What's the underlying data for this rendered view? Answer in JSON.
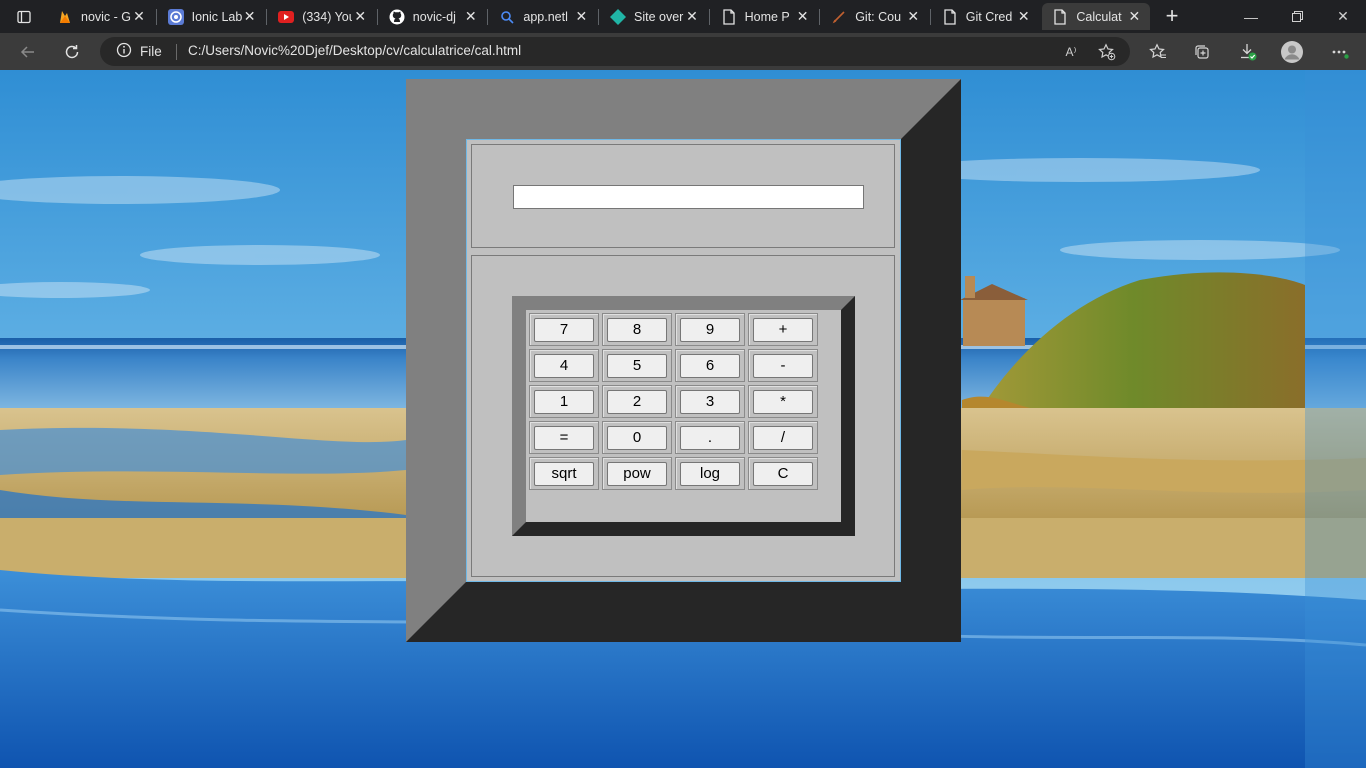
{
  "browser": {
    "tabs": [
      {
        "title": "novic - G",
        "icon": "firebase-icon",
        "active": false
      },
      {
        "title": "Ionic Lab",
        "icon": "ionic-icon",
        "active": false
      },
      {
        "title": "(334) You",
        "icon": "youtube-icon",
        "active": false
      },
      {
        "title": "novic-dj",
        "icon": "github-icon",
        "active": false
      },
      {
        "title": "app.netl",
        "icon": "search-icon",
        "active": false
      },
      {
        "title": "Site over",
        "icon": "netlify-icon",
        "active": false
      },
      {
        "title": "Home P",
        "icon": "page-icon",
        "active": false
      },
      {
        "title": "Git: Cou",
        "icon": "git-icon",
        "active": false
      },
      {
        "title": "Git Cred",
        "icon": "page-icon",
        "active": false
      },
      {
        "title": "Calculat",
        "icon": "page-icon",
        "active": true
      }
    ],
    "site_label": "File",
    "url": "C:/Users/Novic%20Djef/Desktop/cv/calculatrice/cal.html",
    "read_aloud_label": "A⁾"
  },
  "calculator": {
    "display_value": "",
    "keys": [
      [
        "7",
        "8",
        "9",
        "+"
      ],
      [
        "4",
        "5",
        "6",
        "-"
      ],
      [
        "1",
        "2",
        "3",
        "*"
      ],
      [
        "=",
        "0",
        ".",
        "/"
      ],
      [
        "sqrt",
        "pow",
        "log",
        "C"
      ]
    ]
  },
  "colors": {
    "chrome_dark": "#202124",
    "toolbar": "#3b3b3b",
    "frame_light": "#808080",
    "frame_dark": "#262626",
    "panel": "#c0c0c0"
  }
}
